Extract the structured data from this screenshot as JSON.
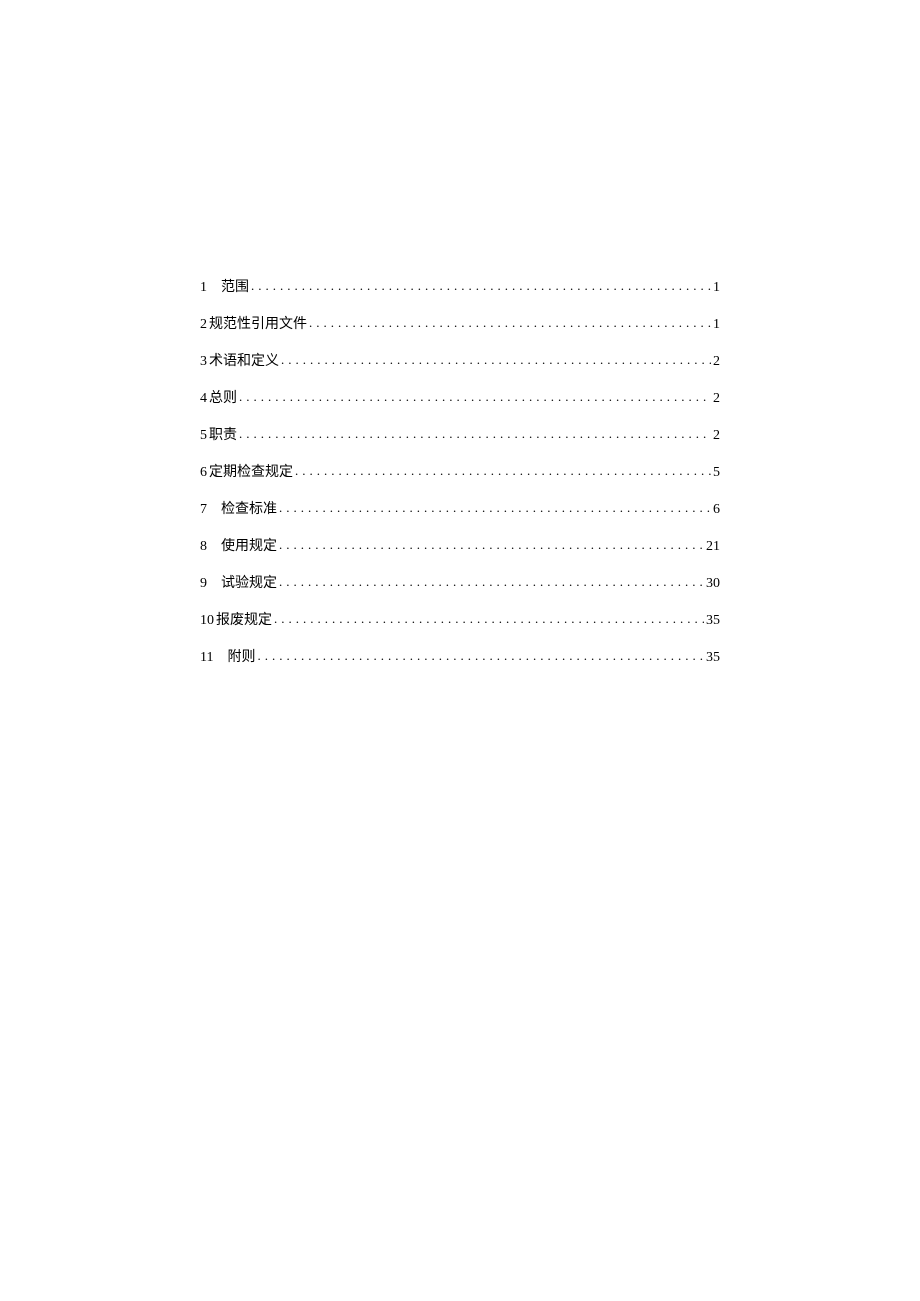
{
  "toc": [
    {
      "num": "1",
      "title": "范围",
      "page": "1",
      "spaced": true
    },
    {
      "num": "2",
      "title": "规范性引用文件",
      "page": "1",
      "spaced": false
    },
    {
      "num": "3",
      "title": "术语和定义",
      "page": "2",
      "spaced": false
    },
    {
      "num": "4",
      "title": "总则",
      "page": "2",
      "spaced": false
    },
    {
      "num": "5",
      "title": "职责",
      "page": "2",
      "spaced": false
    },
    {
      "num": "6",
      "title": "定期检查规定",
      "page": "5",
      "spaced": false
    },
    {
      "num": "7",
      "title": "检查标准",
      "page": "6",
      "spaced": true
    },
    {
      "num": "8",
      "title": "使用规定",
      "page": "21",
      "spaced": true
    },
    {
      "num": "9",
      "title": "试验规定",
      "page": "30",
      "spaced": true
    },
    {
      "num": "10",
      "title": "报废规定",
      "page": "35",
      "spaced": false
    },
    {
      "num": "11",
      "title": "附则",
      "page": "35",
      "spaced": true
    }
  ]
}
